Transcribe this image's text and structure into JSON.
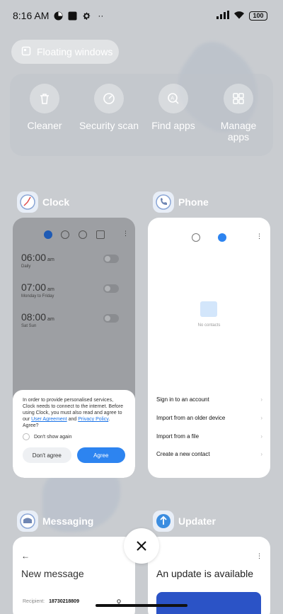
{
  "status": {
    "time": "8:16 AM",
    "battery": "100"
  },
  "floating_windows": {
    "label": "Floating windows",
    "icon": "floating-window-icon"
  },
  "quick_actions": [
    {
      "label": "Cleaner",
      "icon": "trash-icon"
    },
    {
      "label": "Security scan",
      "icon": "security-scan-icon"
    },
    {
      "label": "Find apps",
      "icon": "find-apps-icon"
    },
    {
      "label": "Manage apps",
      "icon": "grid-icon"
    }
  ],
  "apps": {
    "clock": {
      "name": "Clock",
      "alarms": [
        {
          "time": "06:00",
          "suffix": "am",
          "sub": "Daily"
        },
        {
          "time": "07:00",
          "suffix": "am",
          "sub": "Monday to Friday"
        },
        {
          "time": "08:00",
          "suffix": "am",
          "sub": "Sat Sun"
        }
      ],
      "consent": {
        "text_1": "In order to provide personalised services, Clock needs to connect to the internet. Before using Clock, you must also read and agree to our ",
        "link_1": "User Agreement",
        "and": " and ",
        "link_2": "Privacy Policy",
        "text_2": ". Agree?",
        "dont_show": "Don't show again",
        "disagree": "Don't agree",
        "agree": "Agree"
      }
    },
    "phone": {
      "name": "Phone",
      "empty": "No contacts",
      "items": [
        "Sign in to an account",
        "Import from an older device",
        "Import from a file",
        "Create a new contact"
      ]
    },
    "messaging": {
      "name": "Messaging",
      "title": "New message",
      "recipient_label": "Recipient:",
      "recipient_value": "18730218809"
    },
    "updater": {
      "name": "Updater",
      "title": "An update is available"
    }
  },
  "colors": {
    "accent": "#2d84f0"
  }
}
